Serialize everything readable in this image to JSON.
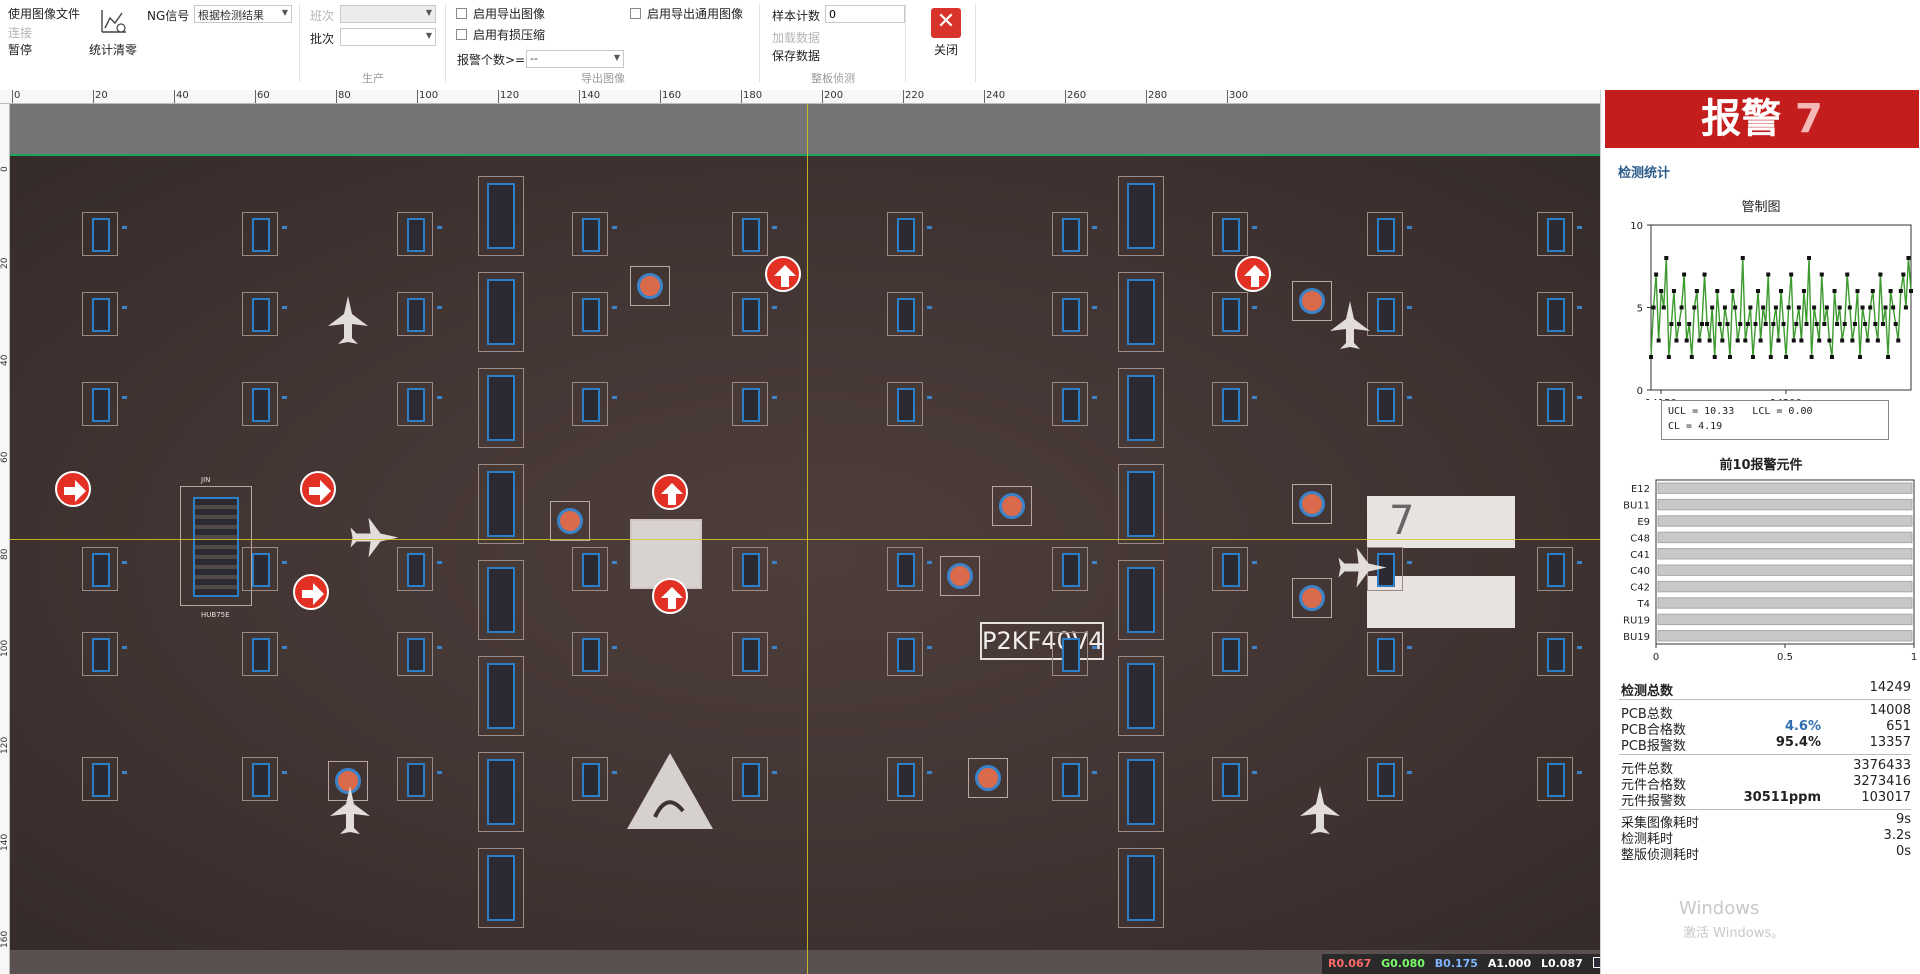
{
  "ribbon": {
    "file_group": {
      "use_image_file": "使用图像文件",
      "connect": "连接",
      "pause": "暂停",
      "stats_clear": "统计清零",
      "ng_signal_label": "NG信号",
      "ng_signal_value": "根据检测结果"
    },
    "production": {
      "shift_label": "班次",
      "shift_value": "",
      "batch_label": "批次",
      "batch_value": "",
      "title": "生产"
    },
    "export": {
      "enable_export": "启用导出图像",
      "enable_compress": "启用有损压缩",
      "enable_general_export": "启用导出通用图像",
      "alarm_count_label": "报警个数>=",
      "alarm_count_value": "--",
      "title": "导出图像"
    },
    "panel_detect": {
      "sample_count_label": "样本计数",
      "sample_count_value": "0",
      "load_data": "加载数据",
      "save_data": "保存数据",
      "title": "整板侦测"
    },
    "close_label": "关闭"
  },
  "ruler": {
    "h_ticks": [
      "0",
      "20",
      "40",
      "60",
      "80",
      "100",
      "120",
      "140",
      "160",
      "180",
      "200",
      "220",
      "240",
      "260",
      "280",
      "300"
    ],
    "v_ticks": [
      "0",
      "20",
      "40",
      "60",
      "80",
      "100",
      "120",
      "140",
      "160"
    ]
  },
  "board": {
    "silk_text": "P2KF40V4",
    "hand_label": "7",
    "header_label": "HUB75E",
    "jin_label": "JIN"
  },
  "status": {
    "r": "R0.067",
    "g": "G0.080",
    "b": "B0.175",
    "a": "A1.000",
    "l": "L0.087"
  },
  "panel": {
    "alarm_label": "报警",
    "alarm_count": "7",
    "section_title": "检测统计",
    "control_chart_title": "管制图",
    "top10_title": "前10报警元件",
    "legend": {
      "ucl": "UCL = 10.33",
      "lcl": "LCL = 0.00",
      "cl": "CL = 4.19"
    },
    "stats": {
      "total_label": "检测总数",
      "total_value": "14249",
      "pcb_total_label": "PCB总数",
      "pcb_total_value": "14008",
      "pcb_ok_label": "PCB合格数",
      "pcb_ok_pct": "4.6%",
      "pcb_ok_value": "651",
      "pcb_alarm_label": "PCB报警数",
      "pcb_alarm_pct": "95.4%",
      "pcb_alarm_value": "13357",
      "comp_total_label": "元件总数",
      "comp_total_value": "3376433",
      "comp_ok_label": "元件合格数",
      "comp_ok_value": "3273416",
      "comp_alarm_label": "元件报警数",
      "comp_alarm_ppm": "30511ppm",
      "comp_alarm_value": "103017",
      "capture_time_label": "采集图像耗时",
      "capture_time_value": "9s",
      "detect_time_label": "检测耗时",
      "detect_time_value": "3.2s",
      "panel_time_label": "整版侦测耗时",
      "panel_time_value": "0s"
    },
    "watermark1": "Windows",
    "watermark2": "激活 Windows。"
  },
  "colors": {
    "alarm_red": "#c41d1d",
    "close_red": "#d9342b",
    "chart_line": "#3c9a2e",
    "bar_gray": "#c8c8c8",
    "status_r": "#ff6b6b",
    "status_g": "#7cff6b",
    "status_b": "#7fb3ff",
    "status_a": "#ffffff",
    "status_l": "#ffffff"
  },
  "chart_data": [
    {
      "type": "line",
      "title": "管制图",
      "xlabel": "",
      "ylabel": "",
      "x_ticks": [
        14150,
        14200
      ],
      "xlim": [
        14146,
        14250
      ],
      "ylim": [
        0,
        10
      ],
      "y_ticks": [
        0,
        5,
        10
      ],
      "ucl": 10.33,
      "lcl": 0.0,
      "cl": 4.19,
      "values": [
        2,
        5,
        7,
        3,
        6,
        5,
        8,
        2,
        4,
        6,
        3,
        4,
        5,
        7,
        3,
        4,
        2,
        5,
        6,
        3,
        4,
        7,
        4,
        3,
        5,
        2,
        6,
        4,
        3,
        5,
        4,
        2,
        6,
        5,
        3,
        4,
        8,
        3,
        4,
        5,
        2,
        4,
        6,
        3,
        5,
        4,
        7,
        2,
        4,
        5,
        3,
        6,
        4,
        2,
        5,
        7,
        3,
        4,
        5,
        3,
        6,
        4,
        8,
        2,
        5,
        4,
        3,
        7,
        4,
        5,
        3,
        2,
        6,
        4,
        5,
        3,
        4,
        7,
        5,
        3,
        4,
        6,
        2,
        5,
        4,
        3,
        5,
        6,
        4,
        3,
        7,
        4,
        5,
        2,
        6,
        5,
        4,
        3,
        6,
        7,
        5,
        8,
        6
      ]
    },
    {
      "type": "bar",
      "orientation": "horizontal",
      "title": "前10报警元件",
      "categories": [
        "E12",
        "BU11",
        "E9",
        "C48",
        "C41",
        "C40",
        "C42",
        "T4",
        "RU19",
        "BU19"
      ],
      "values": [
        1,
        1,
        1,
        1,
        1,
        1,
        1,
        1,
        1,
        1
      ],
      "x_ticks": [
        0,
        0.5,
        1
      ],
      "xlim": [
        0,
        1
      ]
    }
  ]
}
